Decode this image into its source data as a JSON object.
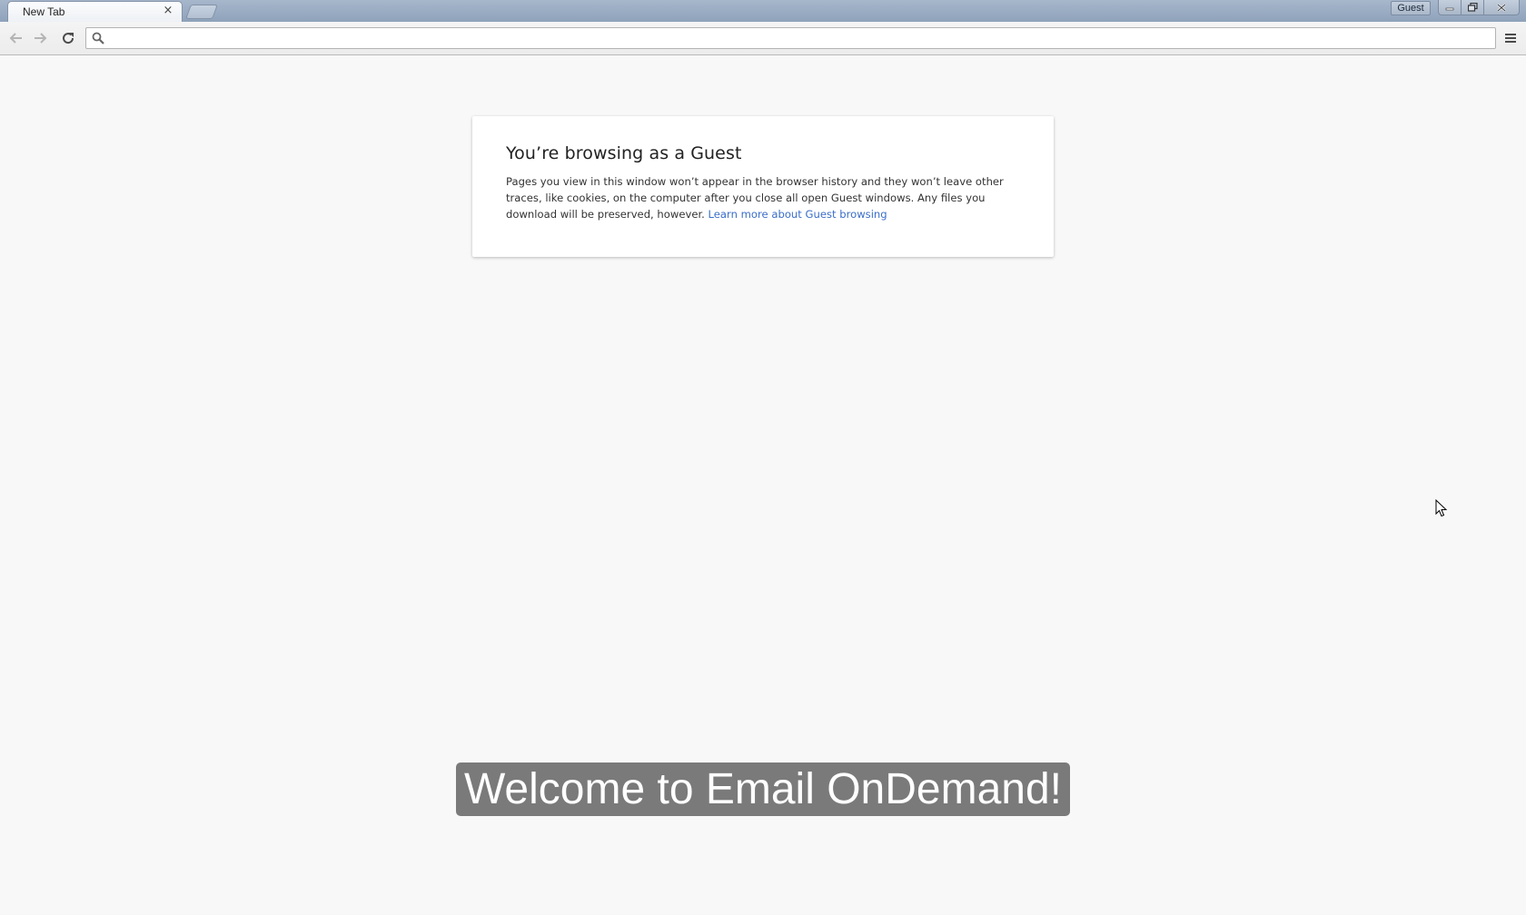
{
  "browser": {
    "tab": {
      "title": "New Tab",
      "close_glyph": "×"
    },
    "new_tab_button": "new-tab",
    "profile": "Guest",
    "window_controls": [
      "minimize",
      "restore",
      "close"
    ],
    "toolbar": {
      "back": "back-arrow",
      "forward": "forward-arrow",
      "reload": "reload",
      "omnibox_value": "",
      "menu": "hamburger-menu"
    }
  },
  "page": {
    "guest_card": {
      "title": "You’re browsing as a Guest",
      "body": "Pages you view in this window won’t appear in the browser history and they won’t leave other traces, like cookies, on the computer after you close all open Guest windows. Any files you download will be preserved, however.",
      "link_text": "Learn more about Guest browsing"
    },
    "caption": "Welcome to Email OnDemand!"
  },
  "colors": {
    "titlebar": "#98abc2",
    "link": "#3b6ec9",
    "caption_bg": "#7a7a7a",
    "page_bg": "#f8f8f8"
  }
}
